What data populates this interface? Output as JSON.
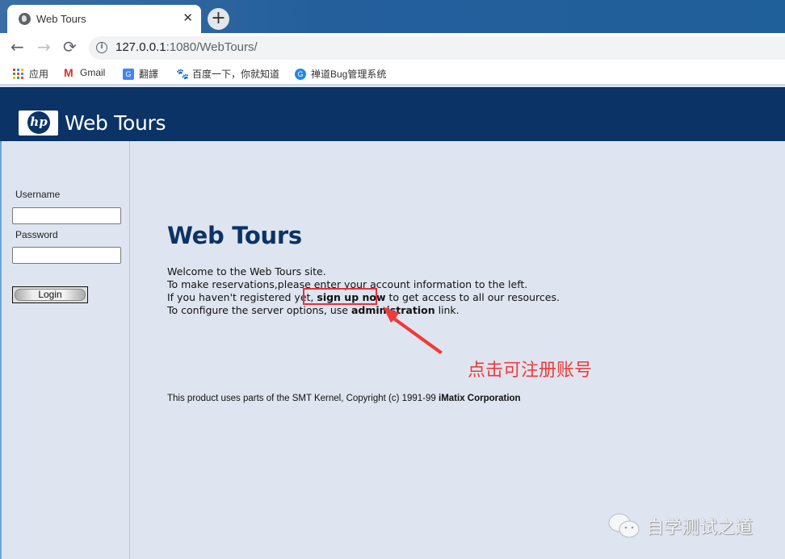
{
  "browser": {
    "tab": {
      "title": "Web Tours",
      "icon": "globe-icon",
      "close": "✕"
    },
    "new_tab": "+",
    "nav": {
      "back": "←",
      "forward": "→",
      "reload": "⟳"
    },
    "address": {
      "host": "127.0.0.1",
      "path": ":1080/WebTours/",
      "info_icon": "i"
    },
    "bookmarks": [
      {
        "label": "应用",
        "icon": "apps-icon"
      },
      {
        "label": "Gmail",
        "icon": "gmail-icon"
      },
      {
        "label": "翻譯",
        "icon": "translate-icon"
      },
      {
        "label": "百度一下，你就知道",
        "icon": "baidu-icon"
      },
      {
        "label": "禅道Bug管理系统",
        "icon": "zentao-icon"
      }
    ]
  },
  "banner": {
    "logo_text": "hp",
    "title": "Web Tours"
  },
  "login": {
    "username_label": "Username",
    "username_value": "",
    "password_label": "Password",
    "password_value": "",
    "login_button": "Login"
  },
  "main": {
    "heading": "Web Tours",
    "line1": "Welcome to the Web Tours site.",
    "line2": "To make reservations,please enter your account information to the left.",
    "line3_pre": "If you haven't registered yet, ",
    "signup_link": "sign up now",
    "line3_post": " to get access to all our resources.",
    "line4_pre": "To configure the server options, use ",
    "admin_link": "administration",
    "line4_post": " link.",
    "footer_pre": "This product uses parts of the SMT Kernel, Copyright (c) 1991-99 ",
    "footer_bold": "iMatix Corporation"
  },
  "annotation": {
    "text": "点击可注册账号",
    "color": "#ee3b3b"
  },
  "watermark": {
    "text": "自学测试之道",
    "icon": "wechat-icon"
  }
}
